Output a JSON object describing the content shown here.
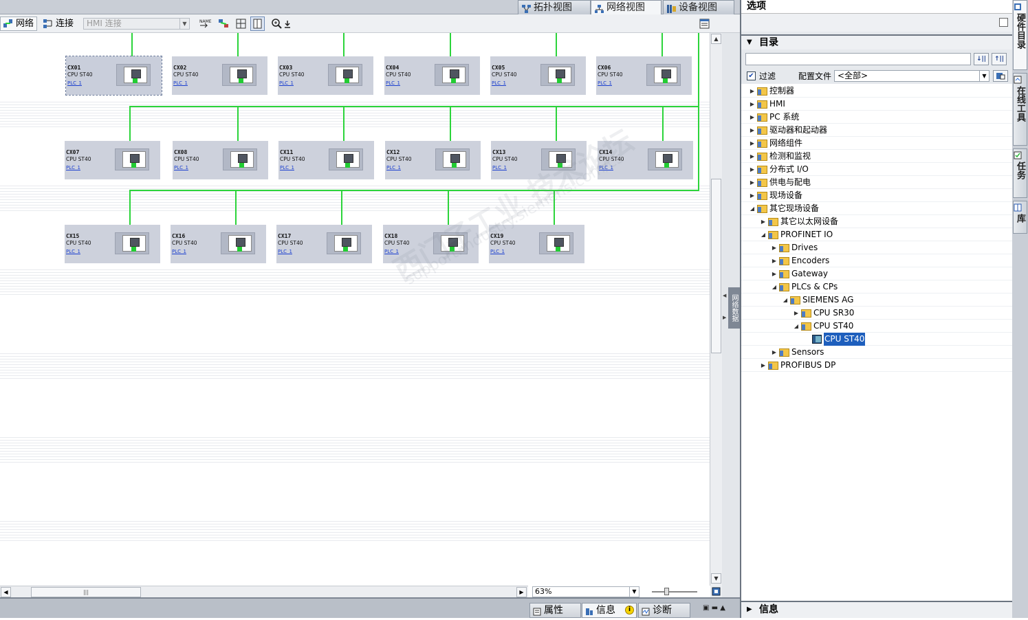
{
  "view_tabs": [
    {
      "label": "拓扑视图",
      "icon": "topology-icon"
    },
    {
      "label": "网络视图",
      "icon": "network-icon"
    },
    {
      "label": "设备视图",
      "icon": "device-icon"
    }
  ],
  "toolbar": {
    "network_label": "网络",
    "connect_label": "连接",
    "hmi_connection_value": "HMI 连接"
  },
  "devices": [
    {
      "name": "CX01",
      "type": "CPU ST40",
      "link": "PLC_1"
    },
    {
      "name": "CX02",
      "type": "CPU ST40",
      "link": "PLC_1"
    },
    {
      "name": "CX03",
      "type": "CPU ST40",
      "link": "PLC_1"
    },
    {
      "name": "CX04",
      "type": "CPU ST40",
      "link": "PLC_1"
    },
    {
      "name": "CX05",
      "type": "CPU ST40",
      "link": "PLC_1"
    },
    {
      "name": "CX06",
      "type": "CPU ST40",
      "link": "PLC_1"
    },
    {
      "name": "CX07",
      "type": "CPU ST40",
      "link": "PLC_1"
    },
    {
      "name": "CX08",
      "type": "CPU ST40",
      "link": "PLC_1"
    },
    {
      "name": "CX11",
      "type": "CPU ST40",
      "link": "PLC_1"
    },
    {
      "name": "CX12",
      "type": "CPU ST40",
      "link": "PLC_1"
    },
    {
      "name": "CX13",
      "type": "CPU ST40",
      "link": "PLC_1"
    },
    {
      "name": "CX14",
      "type": "CPU ST40",
      "link": "PLC_1"
    },
    {
      "name": "CX15",
      "type": "CPU ST40",
      "link": "PLC_1"
    },
    {
      "name": "CX16",
      "type": "CPU ST40",
      "link": "PLC_1"
    },
    {
      "name": "CX17",
      "type": "CPU ST40",
      "link": "PLC_1"
    },
    {
      "name": "CX18",
      "type": "CPU ST40",
      "link": "PLC_1"
    },
    {
      "name": "CX19",
      "type": "CPU ST40",
      "link": "PLC_1"
    }
  ],
  "watermark": {
    "line1": "西门子工业 技术论坛",
    "line2": "support.industry.siemens.com/cs"
  },
  "side_tab_label": "网络数据",
  "zoom": {
    "value": "63%"
  },
  "bottom_tabs": [
    {
      "label": "属性"
    },
    {
      "label": "信息"
    },
    {
      "label": "诊断"
    }
  ],
  "right_panel": {
    "title": "选项",
    "catalog_title": "目录",
    "filter_label": "过滤",
    "filter_checked": true,
    "profile_label": "配置文件",
    "profile_value": "<全部>",
    "info_title": "信息"
  },
  "tree": [
    {
      "label": "控制器",
      "expanded": false
    },
    {
      "label": "HMI",
      "expanded": false
    },
    {
      "label": "PC 系统",
      "expanded": false
    },
    {
      "label": "驱动器和起动器",
      "expanded": false
    },
    {
      "label": "网络组件",
      "expanded": false
    },
    {
      "label": "检测和监视",
      "expanded": false
    },
    {
      "label": "分布式 I/O",
      "expanded": false
    },
    {
      "label": "供电与配电",
      "expanded": false
    },
    {
      "label": "现场设备",
      "expanded": false
    },
    {
      "label": "其它现场设备",
      "expanded": true
    },
    {
      "label": "其它以太网设备",
      "expanded": false
    },
    {
      "label": "PROFINET IO",
      "expanded": true
    },
    {
      "label": "Drives",
      "expanded": false
    },
    {
      "label": "Encoders",
      "expanded": false
    },
    {
      "label": "Gateway",
      "expanded": false
    },
    {
      "label": "PLCs & CPs",
      "expanded": true
    },
    {
      "label": "SIEMENS AG",
      "expanded": true
    },
    {
      "label": "CPU SR30",
      "expanded": false
    },
    {
      "label": "CPU ST40",
      "expanded": true
    },
    {
      "label": "CPU ST40",
      "selected": true
    },
    {
      "label": "Sensors",
      "expanded": false
    },
    {
      "label": "PROFIBUS DP",
      "expanded": false
    }
  ],
  "side_tabs": [
    {
      "label": "硬件目录"
    },
    {
      "label": "在线工具"
    },
    {
      "label": "任务"
    },
    {
      "label": "库"
    }
  ]
}
